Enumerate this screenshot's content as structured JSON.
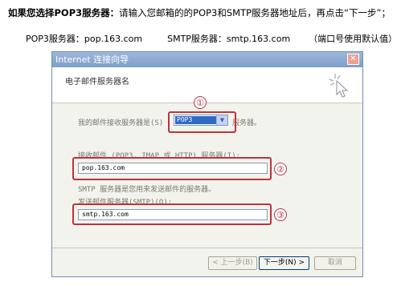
{
  "instructions": {
    "bold": "如果您选择POP3服务器：",
    "rest": "请输入您邮箱的的POP3和SMTP服务器地址后，再点击“下一步”；"
  },
  "servers": {
    "pop3": "POP3服务器：pop.163.com",
    "smtp": "SMTP服务器：smtp.163.com",
    "port": "（端口号使用默认值）"
  },
  "dialog": {
    "title": "Internet 连接向导",
    "close_symbol": "✕",
    "header": "电子邮件服务器名",
    "incoming_type_label": "我的邮件接收服务器是(S)",
    "incoming_type_value": "POP3",
    "incoming_type_suffix": "服务器。",
    "incoming_server_label": "接收邮件 (POP3, IMAP 或 HTTP) 服务器(I):",
    "incoming_server_value": "pop.163.com",
    "smtp_note": "SMTP 服务器是您用来发送邮件的服务器。",
    "outgoing_server_label": "发送邮件服务器(SMTP)(O):",
    "outgoing_server_value": "smtp.163.com",
    "buttons": {
      "back": "< 上一步(B)",
      "next": "下一步(N) >",
      "cancel": "取消"
    }
  },
  "annotations": {
    "n1": "①",
    "n2": "②",
    "n3": "③"
  },
  "colors": {
    "annotation_red": "#c0323a",
    "titlebar": "#7d9dc9",
    "selection_blue": "#316ac5"
  },
  "icons": {
    "close": "close-icon",
    "dropdown": "chevron-down-icon",
    "wizard": "wizard-cursor-icon"
  }
}
